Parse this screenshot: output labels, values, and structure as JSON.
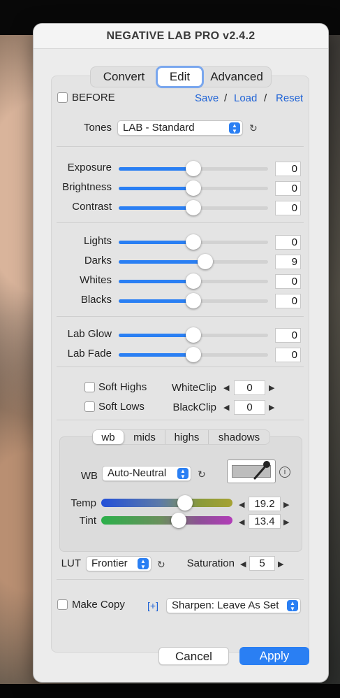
{
  "window": {
    "title": "NEGATIVE LAB PRO v2.4.2"
  },
  "tabs": [
    {
      "label": "Convert"
    },
    {
      "label": "Edit"
    },
    {
      "label": "Advanced"
    }
  ],
  "before": {
    "label": "BEFORE",
    "checked": false
  },
  "presets": {
    "save": "Save",
    "load": "Load",
    "reset": "Reset",
    "sep": "/"
  },
  "tones": {
    "label": "Tones",
    "value": "LAB - Standard"
  },
  "sliders": [
    {
      "label": "Exposure",
      "value": "0",
      "level": 0.5
    },
    {
      "label": "Brightness",
      "value": "0",
      "level": 0.5
    },
    {
      "label": "Contrast",
      "value": "0",
      "level": 0.5
    },
    {
      "label": "Lights",
      "value": "0",
      "level": 0.5
    },
    {
      "label": "Darks",
      "value": "9",
      "level": 0.58
    },
    {
      "label": "Whites",
      "value": "0",
      "level": 0.5
    },
    {
      "label": "Blacks",
      "value": "0",
      "level": 0.5
    },
    {
      "label": "Lab Glow",
      "value": "0",
      "level": 0.5
    },
    {
      "label": "Lab Fade",
      "value": "0",
      "level": 0.5
    }
  ],
  "soft": {
    "highs": "Soft Highs",
    "lows": "Soft Lows"
  },
  "clip": {
    "white_label": "WhiteClip",
    "white_value": "0",
    "black_label": "BlackClip",
    "black_value": "0"
  },
  "color_tabs": [
    {
      "label": "wb"
    },
    {
      "label": "mids"
    },
    {
      "label": "highs"
    },
    {
      "label": "shadows"
    }
  ],
  "wb": {
    "label": "WB",
    "value": "Auto-Neutral"
  },
  "temp": {
    "label": "Temp",
    "value": "19.2",
    "level": 0.64
  },
  "tint": {
    "label": "Tint",
    "value": "13.4",
    "level": 0.59
  },
  "lut": {
    "label": "LUT",
    "value": "Frontier"
  },
  "saturation": {
    "label": "Saturation",
    "value": "5"
  },
  "make_copy": {
    "label": "Make Copy",
    "checked": false
  },
  "plus": "[+]",
  "sharpen": {
    "value": "Sharpen: Leave As Set"
  },
  "buttons": {
    "cancel": "Cancel",
    "apply": "Apply"
  },
  "colors": {
    "accent": "#2a7ff3",
    "link": "#1f63d6",
    "dialog_bg": "#ececec"
  }
}
